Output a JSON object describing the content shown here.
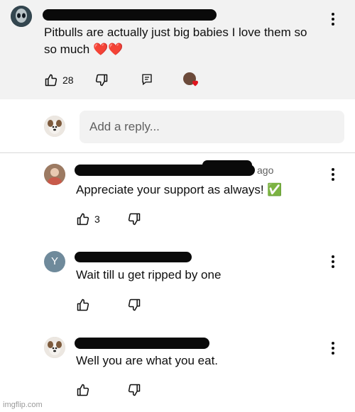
{
  "top_comment": {
    "text": "Pitbulls are actually just big babies I love them so\nso much ❤️❤️",
    "likes": "28"
  },
  "reply_input": {
    "placeholder": "Add a reply..."
  },
  "replies": [
    {
      "time_suffix": "ago",
      "text": "Appreciate your support as always! ✅",
      "likes": "3",
      "avatar_letter": ""
    },
    {
      "time_suffix": "",
      "text": "Wait till u get ripped by one",
      "likes": "",
      "avatar_letter": "Y"
    },
    {
      "time_suffix": "",
      "text": "Well you are what you eat.",
      "likes": "",
      "avatar_letter": ""
    }
  ],
  "watermark": "imgflip.com",
  "colors": {
    "top_comment_bg": "#f2f2f2",
    "avatar_y_bg": "#6f8a9b",
    "heart": "#e0141e"
  }
}
